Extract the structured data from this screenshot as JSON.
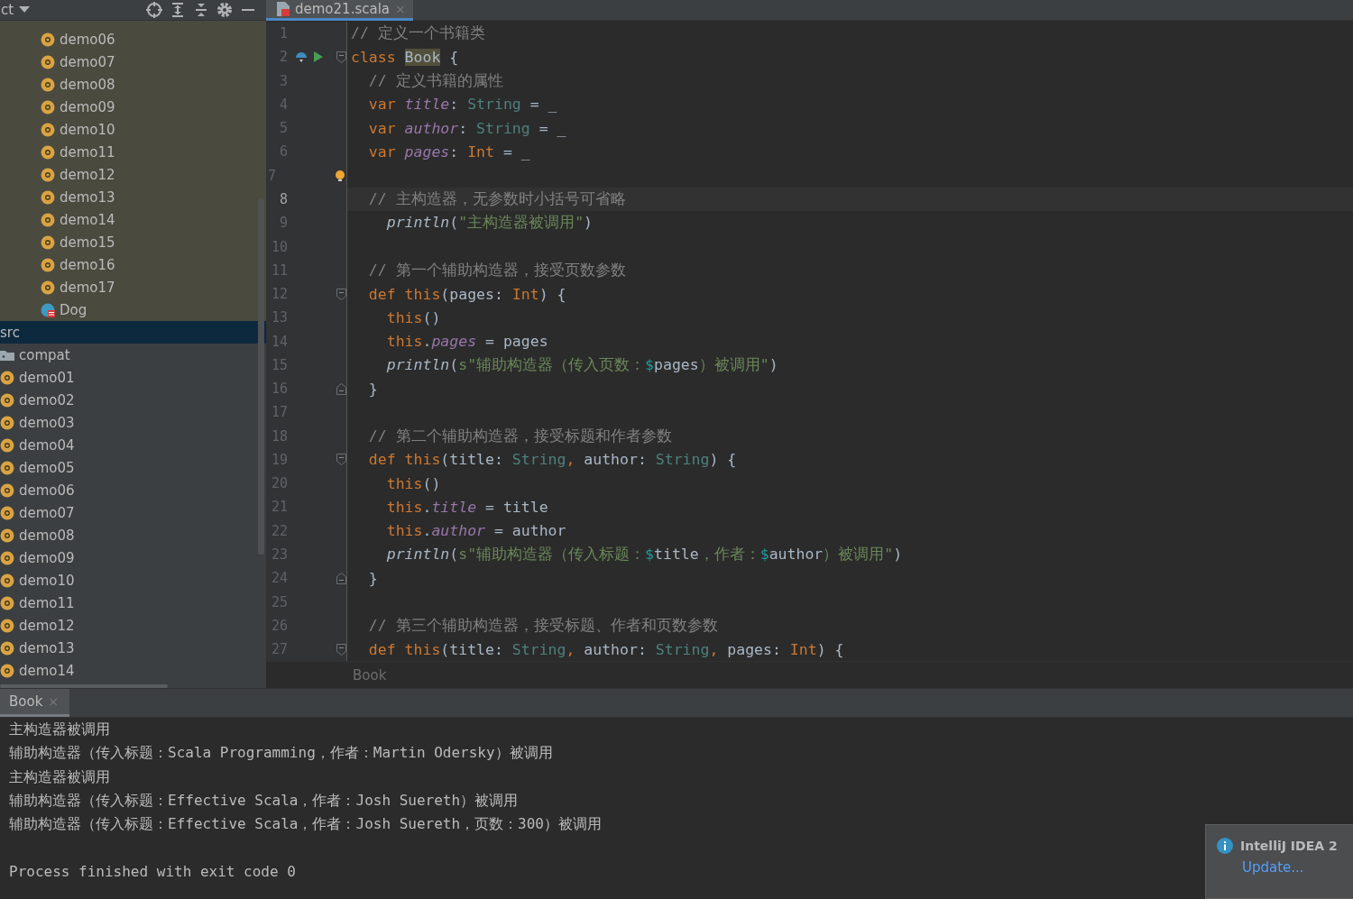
{
  "project_panel": {
    "title": "ct"
  },
  "tree": {
    "scoped_items": [
      {
        "label": "demo06",
        "kind": "object",
        "selected": false
      },
      {
        "label": "demo07",
        "kind": "object",
        "selected": false
      },
      {
        "label": "demo08",
        "kind": "object",
        "selected": false
      },
      {
        "label": "demo09",
        "kind": "object",
        "selected": false
      },
      {
        "label": "demo10",
        "kind": "object",
        "selected": false
      },
      {
        "label": "demo11",
        "kind": "object",
        "selected": false
      },
      {
        "label": "demo12",
        "kind": "object",
        "selected": false
      },
      {
        "label": "demo13",
        "kind": "object",
        "selected": false
      },
      {
        "label": "demo14",
        "kind": "object",
        "selected": false
      },
      {
        "label": "demo15",
        "kind": "object",
        "selected": false
      },
      {
        "label": "demo16",
        "kind": "object",
        "selected": false
      },
      {
        "label": "demo17",
        "kind": "object",
        "selected": false
      },
      {
        "label": "Dog",
        "kind": "class",
        "selected": false
      }
    ],
    "src": {
      "label": "src",
      "selected": true,
      "children": [
        {
          "label": "compat",
          "kind": "folder",
          "selected": false
        },
        {
          "label": "demo01",
          "kind": "object",
          "selected": false
        },
        {
          "label": "demo02",
          "kind": "object",
          "selected": false
        },
        {
          "label": "demo03",
          "kind": "object",
          "selected": false
        },
        {
          "label": "demo04",
          "kind": "object",
          "selected": false
        },
        {
          "label": "demo05",
          "kind": "object",
          "selected": false
        },
        {
          "label": "demo06",
          "kind": "object",
          "selected": false
        },
        {
          "label": "demo07",
          "kind": "object",
          "selected": false
        },
        {
          "label": "demo08",
          "kind": "object",
          "selected": false
        },
        {
          "label": "demo09",
          "kind": "object",
          "selected": false
        },
        {
          "label": "demo10",
          "kind": "object",
          "selected": false
        },
        {
          "label": "demo11",
          "kind": "object",
          "selected": false
        },
        {
          "label": "demo12",
          "kind": "object",
          "selected": false
        },
        {
          "label": "demo13",
          "kind": "object",
          "selected": false
        },
        {
          "label": "demo14",
          "kind": "object",
          "selected": false
        }
      ]
    }
  },
  "editor_tabs": [
    {
      "label": "demo21.scala",
      "selected": true,
      "close": "×"
    }
  ],
  "code_lines": [
    {
      "number": "1",
      "current": false,
      "tokens": [
        {
          "kind": "comment",
          "text": "// 定义一个书籍类"
        }
      ]
    },
    {
      "number": "2",
      "current": false,
      "runnable": true,
      "fold_start": true,
      "tokens": [
        {
          "kind": "kw",
          "text": "class "
        },
        {
          "kind": "highlight",
          "text": "Book"
        },
        {
          "kind": "plain",
          "text": " {"
        }
      ]
    },
    {
      "number": "3",
      "current": false,
      "tokens": [
        {
          "kind": "comment",
          "text": "  // 定义书籍的属性"
        }
      ]
    },
    {
      "number": "4",
      "current": false,
      "tokens": [
        {
          "kind": "kw",
          "text": "  var "
        },
        {
          "kind": "field",
          "text": "title"
        },
        {
          "kind": "plain",
          "text": ": "
        },
        {
          "kind": "type",
          "text": "String"
        },
        {
          "kind": "plain",
          "text": " = _"
        }
      ]
    },
    {
      "number": "5",
      "current": false,
      "tokens": [
        {
          "kind": "kw",
          "text": "  var "
        },
        {
          "kind": "field",
          "text": "author"
        },
        {
          "kind": "plain",
          "text": ": "
        },
        {
          "kind": "type",
          "text": "String"
        },
        {
          "kind": "plain",
          "text": " = _"
        }
      ]
    },
    {
      "number": "6",
      "current": false,
      "tokens": [
        {
          "kind": "kw",
          "text": "  var "
        },
        {
          "kind": "field",
          "text": "pages"
        },
        {
          "kind": "plain",
          "text": ": "
        },
        {
          "kind": "kw",
          "text": "Int"
        },
        {
          "kind": "plain",
          "text": " = _"
        }
      ]
    },
    {
      "number": "7",
      "current": false,
      "hint": true
    },
    {
      "number": "8",
      "current": true,
      "tokens": [
        {
          "kind": "comment",
          "text": "  // 主构造器，无参数时小括号可省略"
        }
      ]
    },
    {
      "number": "9",
      "current": false,
      "tokens": [
        {
          "kind": "fn",
          "text": "    println"
        },
        {
          "kind": "plain",
          "text": "("
        },
        {
          "kind": "str",
          "text": "\"主构造器被调用\""
        },
        {
          "kind": "plain",
          "text": ")"
        }
      ]
    },
    {
      "number": "10",
      "current": false
    },
    {
      "number": "11",
      "current": false,
      "tokens": [
        {
          "kind": "comment",
          "text": "  // 第一个辅助构造器，接受页数参数"
        }
      ]
    },
    {
      "number": "12",
      "current": false,
      "fold_start": true,
      "tokens": [
        {
          "kind": "kw",
          "text": "  def this"
        },
        {
          "kind": "plain",
          "text": "(pages: "
        },
        {
          "kind": "kw",
          "text": "Int"
        },
        {
          "kind": "plain",
          "text": ") {"
        }
      ]
    },
    {
      "number": "13",
      "current": false,
      "tokens": [
        {
          "kind": "kw",
          "text": "    this"
        },
        {
          "kind": "plain",
          "text": "()"
        }
      ]
    },
    {
      "number": "14",
      "current": false,
      "tokens": [
        {
          "kind": "kw",
          "text": "    this"
        },
        {
          "kind": "plain",
          "text": "."
        },
        {
          "kind": "field",
          "text": "pages"
        },
        {
          "kind": "plain",
          "text": " = pages"
        }
      ]
    },
    {
      "number": "15",
      "current": false,
      "tokens": [
        {
          "kind": "fn",
          "text": "    println"
        },
        {
          "kind": "plain",
          "text": "("
        },
        {
          "kind": "str",
          "text": "s\"辅助构造器（传入页数："
        },
        {
          "kind": "interp",
          "text": "$"
        },
        {
          "kind": "plain",
          "text": "pages"
        },
        {
          "kind": "str",
          "text": "）被调用\""
        },
        {
          "kind": "plain",
          "text": ")"
        }
      ]
    },
    {
      "number": "16",
      "current": false,
      "fold_end": true,
      "tokens": [
        {
          "kind": "plain",
          "text": "  }"
        }
      ]
    },
    {
      "number": "17",
      "current": false
    },
    {
      "number": "18",
      "current": false,
      "tokens": [
        {
          "kind": "comment",
          "text": "  // 第二个辅助构造器，接受标题和作者参数"
        }
      ]
    },
    {
      "number": "19",
      "current": false,
      "fold_start": true,
      "tokens": [
        {
          "kind": "kw",
          "text": "  def this"
        },
        {
          "kind": "plain",
          "text": "(title: "
        },
        {
          "kind": "type",
          "text": "String"
        },
        {
          "kind": "kw",
          "text": ", "
        },
        {
          "kind": "plain",
          "text": "author: "
        },
        {
          "kind": "type",
          "text": "String"
        },
        {
          "kind": "plain",
          "text": ") {"
        }
      ]
    },
    {
      "number": "20",
      "current": false,
      "tokens": [
        {
          "kind": "kw",
          "text": "    this"
        },
        {
          "kind": "plain",
          "text": "()"
        }
      ]
    },
    {
      "number": "21",
      "current": false,
      "tokens": [
        {
          "kind": "kw",
          "text": "    this"
        },
        {
          "kind": "plain",
          "text": "."
        },
        {
          "kind": "field",
          "text": "title"
        },
        {
          "kind": "plain",
          "text": " = title"
        }
      ]
    },
    {
      "number": "22",
      "current": false,
      "tokens": [
        {
          "kind": "kw",
          "text": "    this"
        },
        {
          "kind": "plain",
          "text": "."
        },
        {
          "kind": "field",
          "text": "author"
        },
        {
          "kind": "plain",
          "text": " = author"
        }
      ]
    },
    {
      "number": "23",
      "current": false,
      "tokens": [
        {
          "kind": "fn",
          "text": "    println"
        },
        {
          "kind": "plain",
          "text": "("
        },
        {
          "kind": "str",
          "text": "s\"辅助构造器（传入标题："
        },
        {
          "kind": "interp",
          "text": "$"
        },
        {
          "kind": "plain",
          "text": "title"
        },
        {
          "kind": "str",
          "text": "，作者："
        },
        {
          "kind": "interp",
          "text": "$"
        },
        {
          "kind": "plain",
          "text": "author"
        },
        {
          "kind": "str",
          "text": "）被调用\""
        },
        {
          "kind": "plain",
          "text": ")"
        }
      ]
    },
    {
      "number": "24",
      "current": false,
      "fold_end": true,
      "tokens": [
        {
          "kind": "plain",
          "text": "  }"
        }
      ]
    },
    {
      "number": "25",
      "current": false
    },
    {
      "number": "26",
      "current": false,
      "tokens": [
        {
          "kind": "comment",
          "text": "  // 第三个辅助构造器，接受标题、作者和页数参数"
        }
      ]
    },
    {
      "number": "27",
      "current": false,
      "fold_start": true,
      "tokens": [
        {
          "kind": "kw",
          "text": "  def this"
        },
        {
          "kind": "plain",
          "text": "(title: "
        },
        {
          "kind": "type",
          "text": "String"
        },
        {
          "kind": "kw",
          "text": ", "
        },
        {
          "kind": "plain",
          "text": "author: "
        },
        {
          "kind": "type",
          "text": "String"
        },
        {
          "kind": "kw",
          "text": ", "
        },
        {
          "kind": "plain",
          "text": "pages: "
        },
        {
          "kind": "kw",
          "text": "Int"
        },
        {
          "kind": "plain",
          "text": ") {"
        }
      ]
    }
  ],
  "breadcrumb": "Book",
  "run_tabs": [
    {
      "label": "Book",
      "selected": true,
      "close": "×"
    }
  ],
  "output_lines": [
    "主构造器被调用",
    "辅助构造器（传入标题：Scala Programming，作者：Martin Odersky）被调用",
    "主构造器被调用",
    "辅助构造器（传入标题：Effective Scala，作者：Josh Suereth）被调用",
    "辅助构造器（传入标题：Effective Scala，作者：Josh Suereth，页数：300）被调用"
  ],
  "exit_message": "Process finished with exit code 0",
  "notification": {
    "title": "IntelliJ IDEA 2",
    "link": "Update..."
  }
}
